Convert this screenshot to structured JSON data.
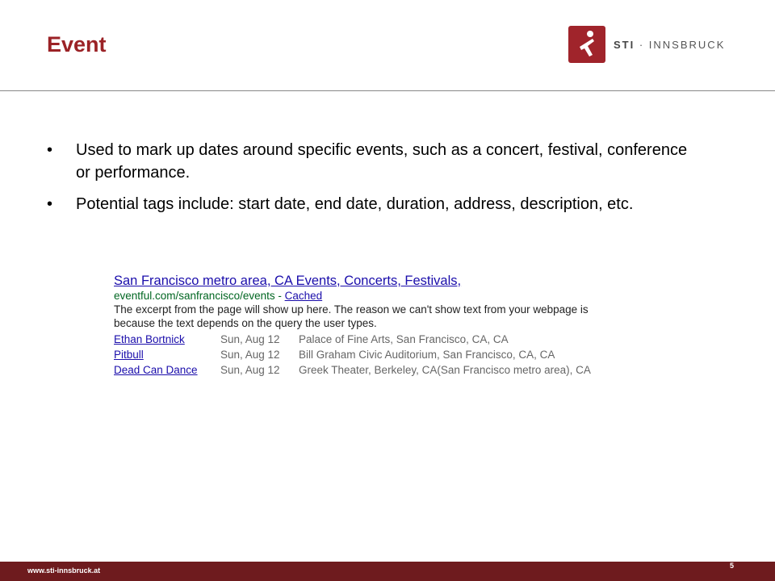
{
  "title": "Event",
  "logo": {
    "brand": "STI",
    "separator": " · ",
    "name": "INNSBRUCK"
  },
  "bullets": [
    "Used to mark up dates around specific events, such as a concert, festival, conference or performance.",
    "Potential tags include: start date, end date, duration, address, description, etc."
  ],
  "bullet_symbol": "•",
  "snippet": {
    "title": "San Francisco metro area, CA Events, Concerts, Festivals,",
    "url": "eventful.com/sanfrancisco/events",
    "url_sep": " - ",
    "cached": "Cached",
    "description": "The excerpt from the page will show up here. The reason we can't show text from your webpage is because the text depends on the query the user types.",
    "events": [
      {
        "name": "Ethan Bortnick",
        "date": "Sun, Aug 12",
        "venue": "Palace of Fine Arts, San Francisco, CA, CA"
      },
      {
        "name": "Pitbull",
        "date": "Sun, Aug 12",
        "venue": "Bill Graham Civic Auditorium, San Francisco, CA, CA"
      },
      {
        "name": "Dead Can Dance",
        "date": "Sun, Aug 12",
        "venue": "Greek Theater, Berkeley, CA(San Francisco metro area), CA"
      }
    ]
  },
  "footer": {
    "url": "www.sti-innsbruck.at",
    "page": "5"
  },
  "colors": {
    "accent": "#9b2226",
    "footer": "#6e1b1e",
    "link": "#1a0dab",
    "url_green": "#006621"
  }
}
